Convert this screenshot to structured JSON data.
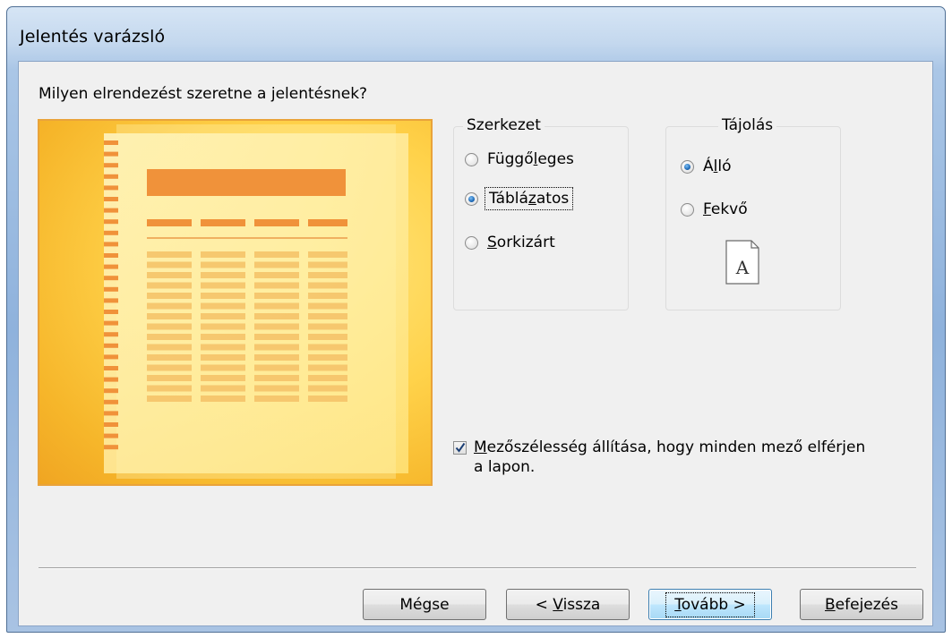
{
  "window": {
    "title": "Jelentés varázsló"
  },
  "prompt": "Milyen elrendezést szeretne a jelentésnek?",
  "layout_group": {
    "label": "Szerkezet",
    "options": [
      {
        "label": "Függőleges",
        "checked": false
      },
      {
        "label": "Táblázatos",
        "checked": true
      },
      {
        "label": "Sorkizárt",
        "checked": false
      }
    ]
  },
  "orientation_group": {
    "label": "Tájolás",
    "options": [
      {
        "label": "Álló",
        "checked": true
      },
      {
        "label": "Fekvő",
        "checked": false
      }
    ],
    "page_icon_letter": "A"
  },
  "adjust_width": {
    "label": "Mezőszélesség állítása, hogy minden mező elférjen a lapon.",
    "checked": true
  },
  "buttons": {
    "cancel": "Mégse",
    "back": "< Vissza",
    "next": "Tovább >",
    "finish": "Befejezés"
  },
  "colors": {
    "preview_accent": "#f0923a",
    "preview_bg": "#ffd24a",
    "radio_selected": "#1f6bb8"
  }
}
